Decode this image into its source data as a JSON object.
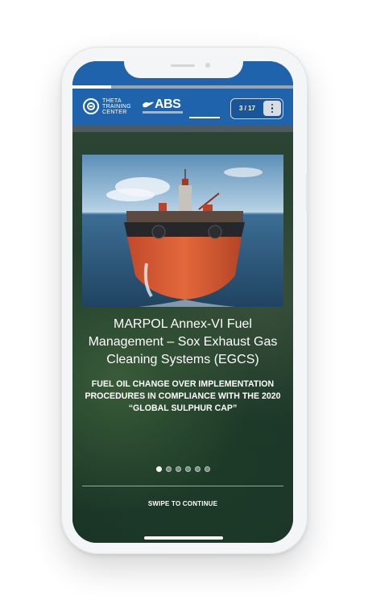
{
  "header": {
    "theta_logo_lines": [
      "THETA",
      "TRAINING",
      "CENTER"
    ],
    "abs_logo": "ABS",
    "page_counter": "3 / 17",
    "progress_fraction": 0.176
  },
  "slide": {
    "title": "MARPOL Annex-VI Fuel Management – Sox Exhaust Gas Cleaning Systems (EGCS)",
    "subtitle": "FUEL OIL CHANGE OVER IMPLEMENTATION PROCEDURES IN COMPLIANCE WITH THE 2020 “GLOBAL SULPHUR CAP”",
    "image_icon": "tanker-ship-photo"
  },
  "pagination": {
    "count": 6,
    "active_index": 0
  },
  "footer": {
    "swipe_label": "SWIPE TO CONTINUE"
  },
  "colors": {
    "header_blue": "#1f63ad",
    "background_green": "#1f3a2a",
    "hull_red": "#d9542e"
  }
}
